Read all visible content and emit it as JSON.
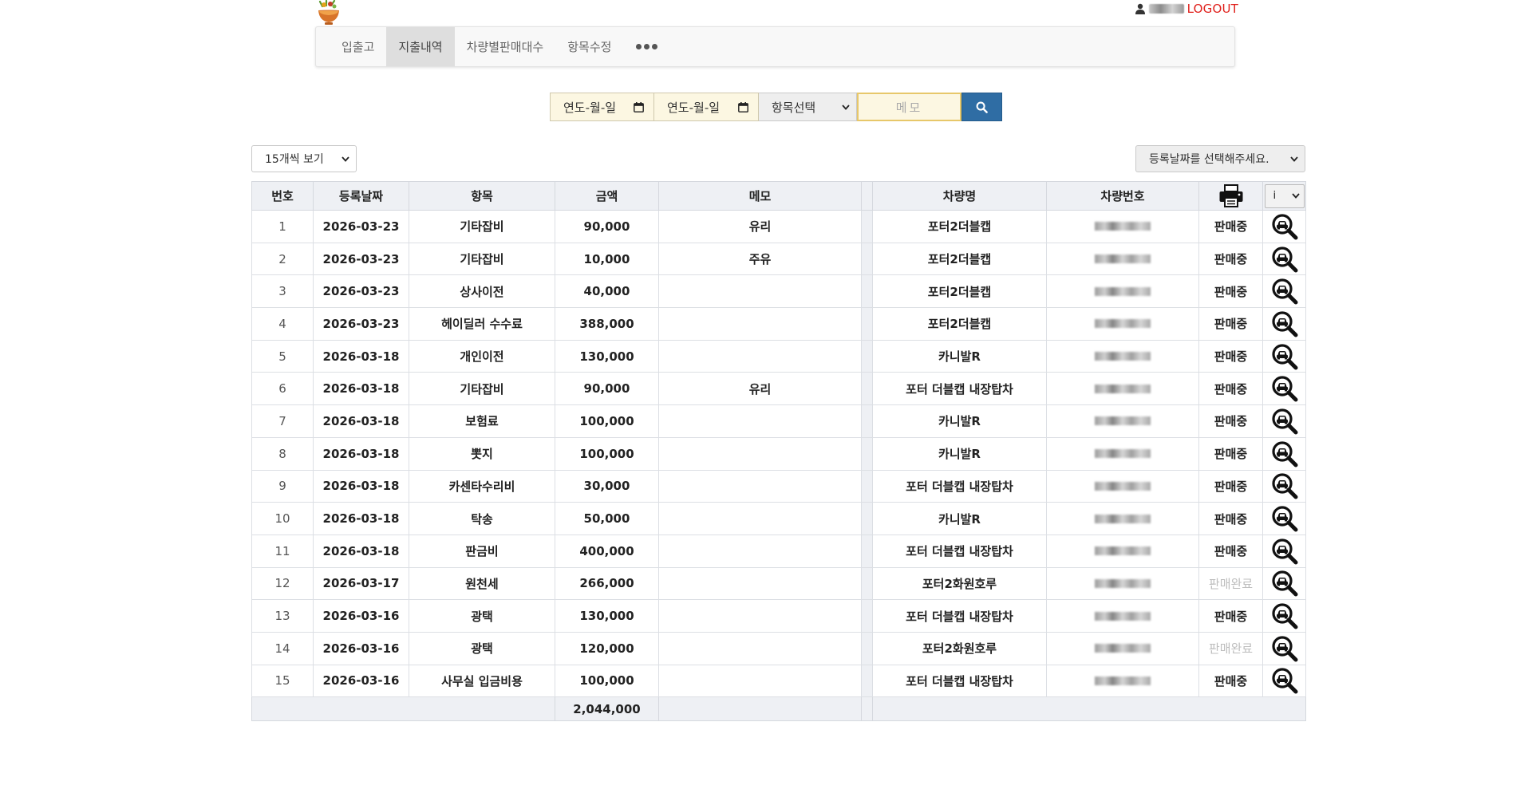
{
  "header": {
    "logout_label": "LOGOUT"
  },
  "nav": {
    "items": [
      {
        "label": "입출고",
        "active": false
      },
      {
        "label": "지출내역",
        "active": true
      },
      {
        "label": "차량별판매대수",
        "active": false
      },
      {
        "label": "항목수정",
        "active": false
      }
    ]
  },
  "search": {
    "start_date_placeholder": "연도-월-일",
    "end_date_placeholder": "연도-월-일",
    "category_selected": "항목선택",
    "memo_placeholder": "메모"
  },
  "list_controls": {
    "page_size_selected": "15개씩 보기",
    "date_filter_selected": "등록날짜를 선택해주세요."
  },
  "table": {
    "headers": {
      "no": "번호",
      "date": "등록날짜",
      "item": "항목",
      "amount": "금액",
      "memo": "메모",
      "car_name": "차량명",
      "car_number": "차량번호",
      "info": "i"
    },
    "rows": [
      {
        "no": "1",
        "date": "2026-03-23",
        "item": "기타잡비",
        "amount": "90,000",
        "memo": "유리",
        "car_name": "포터2더블캡",
        "status": "판매중"
      },
      {
        "no": "2",
        "date": "2026-03-23",
        "item": "기타잡비",
        "amount": "10,000",
        "memo": "주유",
        "car_name": "포터2더블캡",
        "status": "판매중"
      },
      {
        "no": "3",
        "date": "2026-03-23",
        "item": "상사이전",
        "amount": "40,000",
        "memo": "",
        "car_name": "포터2더블캡",
        "status": "판매중"
      },
      {
        "no": "4",
        "date": "2026-03-23",
        "item": "헤이딜러 수수료",
        "amount": "388,000",
        "memo": "",
        "car_name": "포터2더블캡",
        "status": "판매중"
      },
      {
        "no": "5",
        "date": "2026-03-18",
        "item": "개인이전",
        "amount": "130,000",
        "memo": "",
        "car_name": "카니발R",
        "status": "판매중"
      },
      {
        "no": "6",
        "date": "2026-03-18",
        "item": "기타잡비",
        "amount": "90,000",
        "memo": "유리",
        "car_name": "포터 더블캡 내장탑차",
        "status": "판매중"
      },
      {
        "no": "7",
        "date": "2026-03-18",
        "item": "보험료",
        "amount": "100,000",
        "memo": "",
        "car_name": "카니발R",
        "status": "판매중"
      },
      {
        "no": "8",
        "date": "2026-03-18",
        "item": "뽓지",
        "amount": "100,000",
        "memo": "",
        "car_name": "카니발R",
        "status": "판매중"
      },
      {
        "no": "9",
        "date": "2026-03-18",
        "item": "카센타수리비",
        "amount": "30,000",
        "memo": "",
        "car_name": "포터 더블캡 내장탑차",
        "status": "판매중"
      },
      {
        "no": "10",
        "date": "2026-03-18",
        "item": "탁송",
        "amount": "50,000",
        "memo": "",
        "car_name": "카니발R",
        "status": "판매중"
      },
      {
        "no": "11",
        "date": "2026-03-18",
        "item": "판금비",
        "amount": "400,000",
        "memo": "",
        "car_name": "포터 더블캡 내장탑차",
        "status": "판매중"
      },
      {
        "no": "12",
        "date": "2026-03-17",
        "item": "원천세",
        "amount": "266,000",
        "memo": "",
        "car_name": "포터2화원호루",
        "status": "판매완료"
      },
      {
        "no": "13",
        "date": "2026-03-16",
        "item": "광택",
        "amount": "130,000",
        "memo": "",
        "car_name": "포터 더블캡 내장탑차",
        "status": "판매중"
      },
      {
        "no": "14",
        "date": "2026-03-16",
        "item": "광택",
        "amount": "120,000",
        "memo": "",
        "car_name": "포터2화원호루",
        "status": "판매완료"
      },
      {
        "no": "15",
        "date": "2026-03-16",
        "item": "사무실 입금비용",
        "amount": "100,000",
        "memo": "",
        "car_name": "포터 더블캡 내장탑차",
        "status": "판매중"
      }
    ],
    "total_amount": "2,044,000"
  },
  "colors": {
    "logout": "#e0201b",
    "search_button": "#2f6da4",
    "input_bg": "#fcf7e2",
    "header_bg": "#eef0f4"
  },
  "icons": {
    "logo": "bowl-logo-icon",
    "user": "user-icon",
    "calendar": "calendar-icon",
    "search": "search-icon",
    "print": "printer-icon",
    "row_action": "magnifier-car-icon"
  }
}
